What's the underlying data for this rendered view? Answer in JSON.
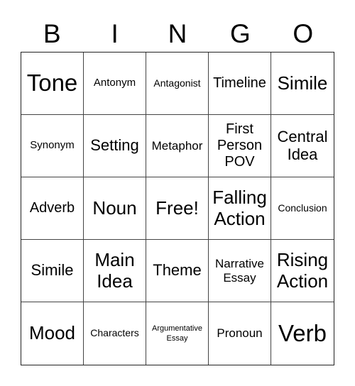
{
  "header": {
    "letters": [
      "B",
      "I",
      "N",
      "G",
      "O"
    ]
  },
  "board": {
    "rows": [
      [
        "Tone",
        "Antonym",
        "Antagonist",
        "Timeline",
        "Simile"
      ],
      [
        "Synonym",
        "Setting",
        "Metaphor",
        "First Person POV",
        "Central Idea"
      ],
      [
        "Adverb",
        "Noun",
        "Free!",
        "Falling Action",
        "Conclusion"
      ],
      [
        "Simile",
        "Main Idea",
        "Theme",
        "Narrative Essay",
        "Rising Action"
      ],
      [
        "Mood",
        "Characters",
        "Argumentative Essay",
        "Pronoun",
        "Verb"
      ]
    ],
    "free_space": "Free!"
  },
  "colors": {
    "background": "#ffffff",
    "text": "#000000",
    "grid_line": "#444444"
  }
}
